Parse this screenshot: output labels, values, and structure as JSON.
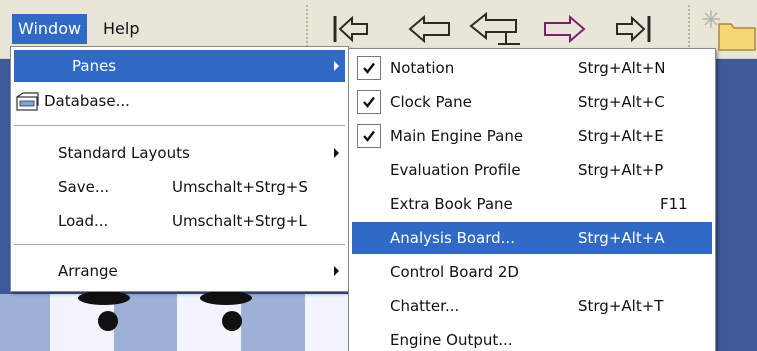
{
  "menubar": {
    "window_label": "Window",
    "help_label": "Help"
  },
  "toolbar": {
    "buttons": [
      {
        "icon": "first-move-icon"
      },
      {
        "icon": "back-icon"
      },
      {
        "icon": "take-back-icon"
      },
      {
        "icon": "forward-icon"
      },
      {
        "icon": "last-move-icon"
      },
      {
        "icon": "new-folder-icon"
      }
    ]
  },
  "window_menu": {
    "items": [
      {
        "label": "Panes",
        "shortcut": "",
        "submenu": true,
        "highlighted": true
      },
      {
        "label": "Database...",
        "shortcut": "",
        "icon": "database-icon"
      },
      {
        "label": "Standard Layouts",
        "shortcut": "",
        "submenu": true
      },
      {
        "label": "Save...",
        "shortcut": "Umschalt+Strg+S"
      },
      {
        "label": "Load...",
        "shortcut": "Umschalt+Strg+L"
      },
      {
        "label": "Arrange",
        "shortcut": "",
        "submenu": true
      }
    ]
  },
  "panes_menu": {
    "items": [
      {
        "label": "Notation",
        "shortcut": "Strg+Alt+N",
        "checked": true
      },
      {
        "label": "Clock Pane",
        "shortcut": "Strg+Alt+C",
        "checked": true
      },
      {
        "label": "Main Engine Pane",
        "shortcut": "Strg+Alt+E",
        "checked": true
      },
      {
        "label": "Evaluation Profile",
        "shortcut": "Strg+Alt+P",
        "checked": false
      },
      {
        "label": "Extra Book Pane",
        "shortcut": "F11",
        "checked": false
      },
      {
        "label": "Analysis Board...",
        "shortcut": "Strg+Alt+A",
        "checked": false,
        "highlighted": true
      },
      {
        "label": "Control Board 2D",
        "shortcut": "",
        "checked": false
      },
      {
        "label": "Chatter...",
        "shortcut": "Strg+Alt+T",
        "checked": false
      },
      {
        "label": "Engine Output...",
        "shortcut": "",
        "checked": false
      }
    ]
  },
  "colors": {
    "highlight": "#316ac5",
    "menubar": "#e9e6d8",
    "board_dark": "#3e5a98"
  }
}
